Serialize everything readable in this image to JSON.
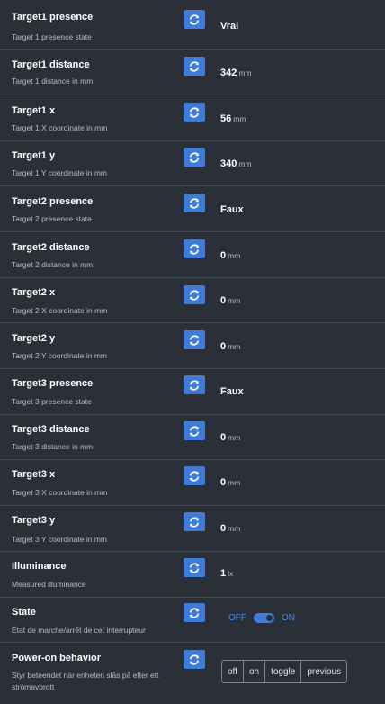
{
  "colors": {
    "background": "#2b3038",
    "button": "#3e7cd8",
    "toggle_text": "#3e8ee8",
    "divider": "#454b55"
  },
  "refresh_icon": "refresh-icon",
  "rows": [
    {
      "title": "Target1 presence",
      "description": "Target 1 presence state",
      "value": "Vrai",
      "unit": ""
    },
    {
      "title": "Target1 distance",
      "description": "Target 1 distance in mm",
      "value": "342",
      "unit": "mm"
    },
    {
      "title": "Target1 x",
      "description": "Target 1 X coordinate in mm",
      "value": "56",
      "unit": "mm"
    },
    {
      "title": "Target1 y",
      "description": "Target 1 Y coordinate in mm",
      "value": "340",
      "unit": "mm"
    },
    {
      "title": "Target2 presence",
      "description": "Target 2 presence state",
      "value": "Faux",
      "unit": ""
    },
    {
      "title": "Target2 distance",
      "description": "Target 2 distance in mm",
      "value": "0",
      "unit": "mm"
    },
    {
      "title": "Target2 x",
      "description": "Target 2 X coordinate in mm",
      "value": "0",
      "unit": "mm"
    },
    {
      "title": "Target2 y",
      "description": "Target 2 Y coordinate in mm",
      "value": "0",
      "unit": "mm"
    },
    {
      "title": "Target3 presence",
      "description": "Target 3 presence state",
      "value": "Faux",
      "unit": ""
    },
    {
      "title": "Target3 distance",
      "description": "Target 3 distance in mm",
      "value": "0",
      "unit": "mm"
    },
    {
      "title": "Target3 x",
      "description": "Target 3 X coordinate in mm",
      "value": "0",
      "unit": "mm"
    },
    {
      "title": "Target3 y",
      "description": "Target 3 Y coordinate in mm",
      "value": "0",
      "unit": "mm"
    },
    {
      "title": "Illuminance",
      "description": "Measured illuminance",
      "value": "1",
      "unit": "lx"
    }
  ],
  "state": {
    "title": "State",
    "description": "État de marche/arrêt de cet interrupteur",
    "off_label": "OFF",
    "on_label": "ON",
    "is_on": true
  },
  "power_on": {
    "title": "Power-on behavior",
    "description": "Styr beteendet när enheten slås på efter ett strömavbrott",
    "options": [
      "off",
      "on",
      "toggle",
      "previous"
    ]
  }
}
